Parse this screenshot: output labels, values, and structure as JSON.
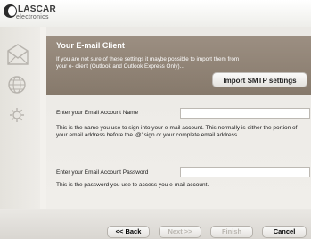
{
  "header": {
    "brand_name": "LASCAR",
    "brand_sub": "electronics"
  },
  "sidebar": {
    "icons": [
      "envelope-icon",
      "globe-icon",
      "gear-icon"
    ]
  },
  "banner": {
    "title": "Your E-mail Client",
    "text": "If you are not sure of these settings it maybe possible to import them from your e- client (Outlook and Outlook Express Only)...",
    "import_button": "Import SMTP settings"
  },
  "form": {
    "account_name_label": "Enter your Email Account Name",
    "account_name_value": "",
    "account_name_help": "This is the name you use to sign into your e-mail account. This normally is either the portion of your email address before the '@' sign or your complete email address.",
    "password_label": "Enter your Email Account Password",
    "password_value": "",
    "password_help": "This is the password you use to access you e-mail account."
  },
  "footer": {
    "back": "<< Back",
    "next": "Next >>",
    "finish": "Finish",
    "cancel": "Cancel"
  }
}
